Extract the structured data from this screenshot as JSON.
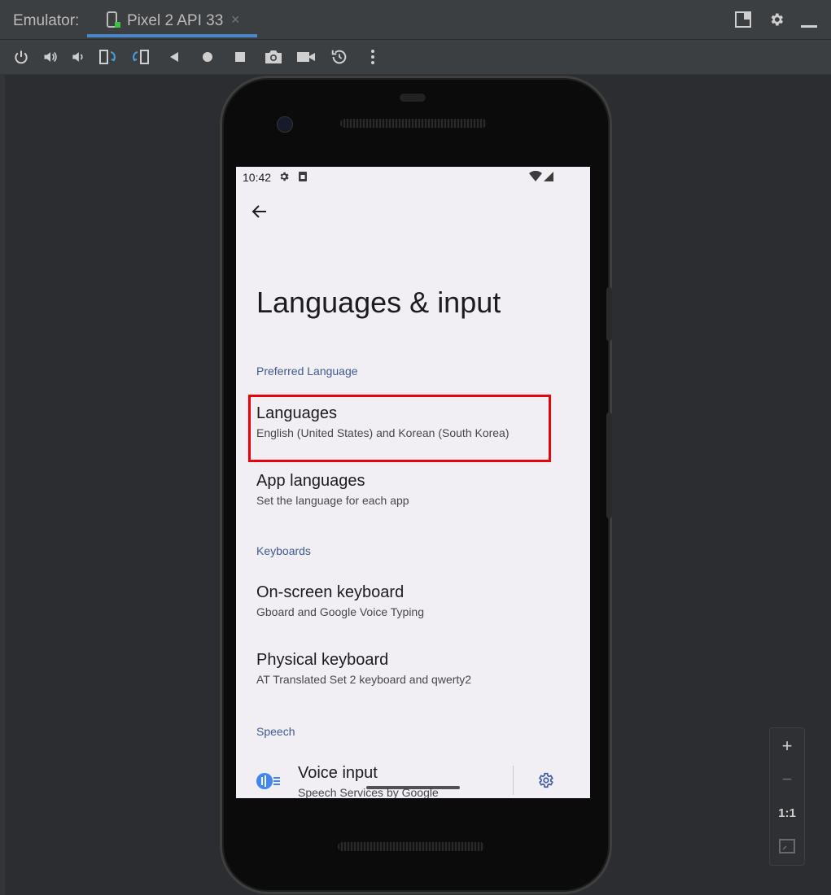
{
  "ide": {
    "tool_window_title": "Emulator:",
    "tab_label": "Pixel 2 API 33",
    "tab_close": "×"
  },
  "toolbar": {
    "icons": [
      "power-icon",
      "volume-up-icon",
      "volume-down-icon",
      "rotate-left-icon",
      "rotate-right-icon",
      "back-icon",
      "home-icon",
      "overview-icon",
      "screenshot-icon",
      "screen-record-icon",
      "snapshot-icon",
      "more-icon"
    ]
  },
  "device": {
    "status_time": "10:42",
    "screen": {
      "title": "Languages & input",
      "sections": [
        {
          "header": "Preferred Language",
          "items": [
            {
              "title": "Languages",
              "subtitle": "English (United States) and Korean (South Korea)"
            },
            {
              "title": "App languages",
              "subtitle": "Set the language for each app"
            }
          ]
        },
        {
          "header": "Keyboards",
          "items": [
            {
              "title": "On-screen keyboard",
              "subtitle": "Gboard and Google Voice Typing"
            },
            {
              "title": "Physical keyboard",
              "subtitle": "AT Translated Set 2 keyboard and qwerty2"
            }
          ]
        },
        {
          "header": "Speech",
          "items": [
            {
              "title": "Voice input",
              "subtitle": "Speech Services by Google"
            }
          ]
        }
      ]
    }
  },
  "zoom": {
    "zoom_in": "+",
    "zoom_out": "−",
    "actual_size": "1:1"
  },
  "colors": {
    "highlight": "#e8000b",
    "section_header": "#3f5a93",
    "screen_bg": "#f1eff4",
    "tab_accent": "#4a88c7"
  }
}
